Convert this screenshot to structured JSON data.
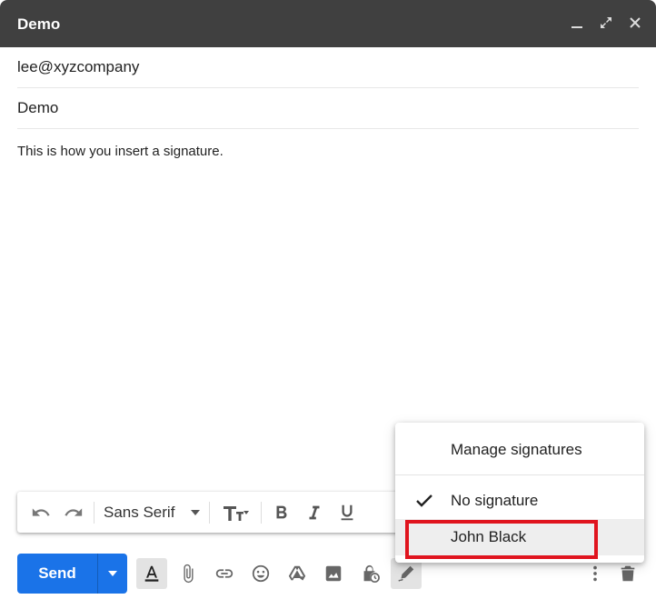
{
  "window": {
    "title": "Demo",
    "controls": [
      "minimize-icon",
      "expand-icon",
      "close-icon"
    ]
  },
  "compose": {
    "to": "lee@xyzcompany",
    "subject": "Demo",
    "body": "This is how you insert a signature."
  },
  "format_toolbar": {
    "icons": [
      "undo-icon",
      "redo-icon",
      "text-size-icon",
      "bold-icon",
      "italic-icon",
      "underline-icon"
    ],
    "font": "Sans Serif"
  },
  "bottom_toolbar": {
    "send_label": "Send",
    "icons": [
      "formatting-icon",
      "attach-icon",
      "link-icon",
      "emoji-icon",
      "drive-icon",
      "photo-icon",
      "confidential-icon",
      "signature-icon",
      "more-options-icon",
      "trash-icon"
    ]
  },
  "signature_menu": {
    "manage": "Manage signatures",
    "items": [
      {
        "label": "No signature",
        "checked": true
      },
      {
        "label": "John Black",
        "checked": false
      }
    ]
  },
  "colors": {
    "titlebar": "#404040",
    "send": "#1a73e8",
    "highlight": "#e0141e"
  }
}
